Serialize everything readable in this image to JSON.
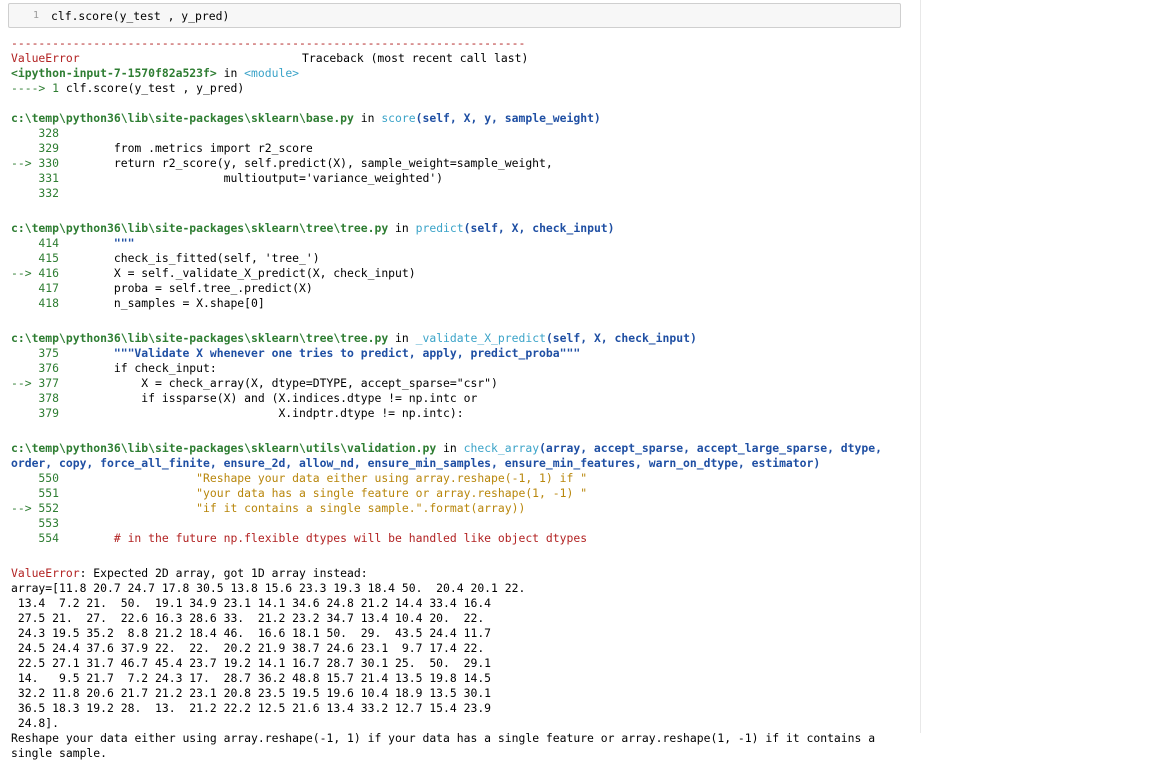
{
  "input_cell": {
    "line_number": "1",
    "code": "clf.score(y_test , y_pred)"
  },
  "traceback": {
    "separator": "---------------------------------------------------------------------------",
    "error_name": "ValueError",
    "header_right": "Traceback (most recent call last)",
    "input_ref": "<ipython-input-7-1570f82a523f>",
    "in_word": " in ",
    "module": "<module>",
    "first_arrow": "----> 1 ",
    "first_code": "clf.score(y_test , y_pred)",
    "frames": [
      {
        "path": "c:\\temp\\python36\\lib\\site-packages\\sklearn\\base.py",
        "func": "score",
        "args": "(self, X, y, sample_weight)",
        "lines": [
          {
            "n": "328",
            "code": ""
          },
          {
            "n": "329",
            "code": "        from .metrics import r2_score"
          },
          {
            "n": "330",
            "arrow": true,
            "code": "        return r2_score(y, self.predict(X), sample_weight=sample_weight,"
          },
          {
            "n": "331",
            "code": "                        multioutput='variance_weighted')"
          },
          {
            "n": "332",
            "code": ""
          }
        ]
      },
      {
        "path": "c:\\temp\\python36\\lib\\site-packages\\sklearn\\tree\\tree.py",
        "func": "predict",
        "args": "(self, X, check_input)",
        "lines": [
          {
            "n": "414",
            "code": "        \"\"\""
          },
          {
            "n": "415",
            "code": "        check_is_fitted(self, 'tree_')"
          },
          {
            "n": "416",
            "arrow": true,
            "code": "        X = self._validate_X_predict(X, check_input)"
          },
          {
            "n": "417",
            "code": "        proba = self.tree_.predict(X)"
          },
          {
            "n": "418",
            "code": "        n_samples = X.shape[0]"
          }
        ]
      },
      {
        "path": "c:\\temp\\python36\\lib\\site-packages\\sklearn\\tree\\tree.py",
        "func": "_validate_X_predict",
        "args": "(self, X, check_input)",
        "lines": [
          {
            "n": "375",
            "code": "        \"\"\"Validate X whenever one tries to predict, apply, predict_proba\"\"\""
          },
          {
            "n": "376",
            "code": "        if check_input:"
          },
          {
            "n": "377",
            "arrow": true,
            "code": "            X = check_array(X, dtype=DTYPE, accept_sparse=\"csr\")"
          },
          {
            "n": "378",
            "code": "            if issparse(X) and (X.indices.dtype != np.intc or"
          },
          {
            "n": "379",
            "code": "                                X.indptr.dtype != np.intc):"
          }
        ]
      },
      {
        "path": "c:\\temp\\python36\\lib\\site-packages\\sklearn\\utils\\validation.py",
        "func": "check_array",
        "args": "(array, accept_sparse, accept_large_sparse, dtype,",
        "args2": "order, copy, force_all_finite, ensure_2d, allow_nd, ensure_min_samples, ensure_min_features, warn_on_dtype, estimator)",
        "lines": [
          {
            "n": "550",
            "code": "                    \"Reshape your data either using array.reshape(-1, 1) if \""
          },
          {
            "n": "551",
            "code": "                    \"your data has a single feature or array.reshape(1, -1) \""
          },
          {
            "n": "552",
            "arrow": true,
            "code": "                    \"if it contains a single sample.\".format(array))"
          },
          {
            "n": "553",
            "code": ""
          },
          {
            "n": "554",
            "code": "        # in the future np.flexible dtypes will be handled like object dtypes"
          }
        ]
      }
    ],
    "final_error_name": "ValueError",
    "final_message": ": Expected 2D array, got 1D array instead:",
    "array_lines": [
      "array=[11.8 20.7 24.7 17.8 30.5 13.8 15.6 23.3 19.3 18.4 50.  20.4 20.1 22.",
      " 13.4  7.2 21.  50.  19.1 34.9 23.1 14.1 34.6 24.8 21.2 14.4 33.4 16.4",
      " 27.5 21.  27.  22.6 16.3 28.6 33.  21.2 23.2 34.7 13.4 10.4 20.  22.",
      " 24.3 19.5 35.2  8.8 21.2 18.4 46.  16.6 18.1 50.  29.  43.5 24.4 11.7",
      " 24.5 24.4 37.6 37.9 22.  22.  20.2 21.9 38.7 24.6 23.1  9.7 17.4 22.",
      " 22.5 27.1 31.7 46.7 45.4 23.7 19.2 14.1 16.7 28.7 30.1 25.  50.  29.1",
      " 14.   9.5 21.7  7.2 24.3 17.  28.7 36.2 48.8 15.7 21.4 13.5 19.8 14.5",
      " 32.2 11.8 20.6 21.7 21.2 23.1 20.8 23.5 19.5 19.6 10.4 18.9 13.5 30.1",
      " 36.5 18.3 19.2 28.  13.  21.2 22.2 12.5 21.6 13.4 33.2 12.7 15.4 23.9",
      " 24.8].",
      "Reshape your data either using array.reshape(-1, 1) if your data has a single feature or array.reshape(1, -1) if it contains a",
      "single sample."
    ]
  },
  "colors": {
    "error": "#b22222",
    "line_numbers": "#2e7d32",
    "function": "#3aa3c8",
    "args": "#1f4fa3"
  }
}
